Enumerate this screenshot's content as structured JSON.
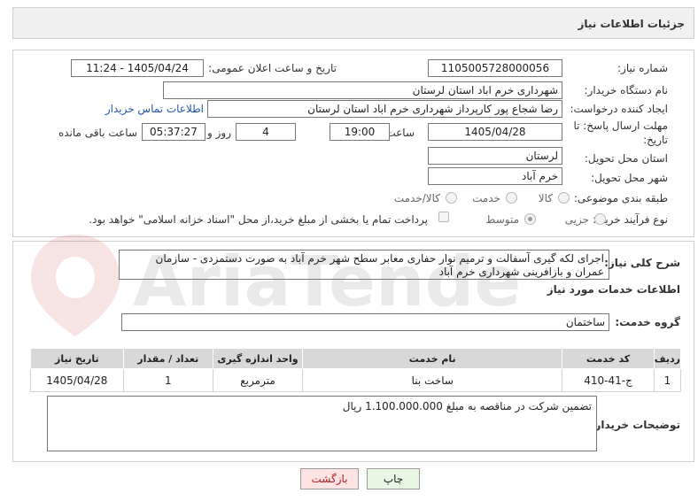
{
  "header": {
    "title": "جزئیات اطلاعات نیاز"
  },
  "form": {
    "need_number_label": "شماره نیاز:",
    "need_number": "1105005728000056",
    "announce_label": "تاریخ و ساعت اعلان عمومی:",
    "announce_value": "1405/04/24 - 11:24",
    "buyer_org_label": "نام دستگاه خریدار:",
    "buyer_org": "شهرداری خرم اباد استان لرستان",
    "requester_label": "ایجاد کننده درخواست:",
    "requester": "رضا شجاع پور کارپرداز شهرداری خرم اباد استان لرستان",
    "contact_link": "اطلاعات تماس خریدار",
    "deadline_label_1": "مهلت ارسال پاسخ: تا",
    "deadline_label_2": "تاریخ:",
    "deadline_date": "1405/04/28",
    "time_label": "ساعت",
    "deadline_time": "19:00",
    "days_count": "4",
    "days_label": "روز و",
    "remaining_time": "05:37:27",
    "remaining_label": "ساعت باقی مانده",
    "province_label": "استان محل تحویل:",
    "province": "لرستان",
    "city_label": "شهر محل تحویل:",
    "city": "خرم آباد",
    "category_label": "طبقه بندی موضوعی:",
    "category_options": [
      "کالا",
      "خدمت",
      "کالا/خدمت"
    ],
    "process_label": "نوع فرآیند خرید :",
    "process_options": [
      "جزیی",
      "متوسط"
    ],
    "payment_note": "پرداخت تمام یا بخشی از مبلغ خرید،از محل \"اسناد خزانه اسلامی\" خواهد بود."
  },
  "details": {
    "summary_label": "شرح کلی نیاز:",
    "summary": "اجرای لکه گیری آسفالت و ترمیم نوار حفاری معابر سطح شهر خرم آباد به صورت دستمزدی - سازمان عمران و بازافرینی شهرداری خرم آباد",
    "services_heading": "اطلاعات خدمات مورد نیاز",
    "service_group_label": "گروه خدمت:",
    "service_group": "ساختمان",
    "table": {
      "headers": [
        "ردیف",
        "کد خدمت",
        "نام خدمت",
        "واحد اندازه گیری",
        "تعداد / مقدار",
        "تاریخ نیاز"
      ],
      "rows": [
        [
          "1",
          "ج-41-410",
          "ساخت بنا",
          "مترمربع",
          "1",
          "1405/04/28"
        ]
      ]
    },
    "buyer_notes_label": "توضیحات خریدار:",
    "buyer_notes": "تضمین شرکت در مناقصه به مبلغ 1.100.000.000 ریال"
  },
  "buttons": {
    "print": "چاپ",
    "back": "بازگشت"
  },
  "watermark_text": "AriaTender.neT",
  "colors": {
    "link": "#2356a6",
    "print_bg": "#e8f7e4",
    "back_bg": "#fde4e4",
    "table_header": "#d8d8d8"
  }
}
